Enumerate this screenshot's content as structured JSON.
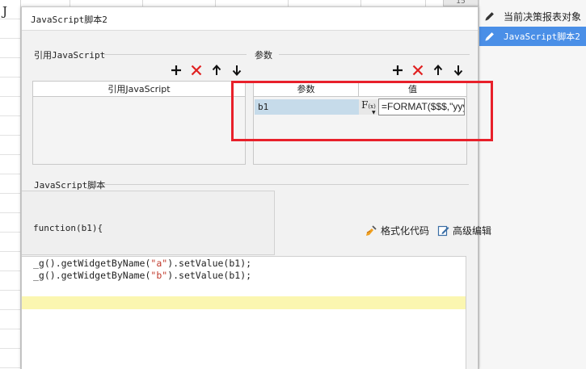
{
  "spreadsheet": {
    "column_label": "J",
    "cell_number": "15"
  },
  "dialog": {
    "title": "JavaScript脚本2"
  },
  "ref_section": {
    "title": "引用JavaScript",
    "column_header": "引用JavaScript"
  },
  "param_section": {
    "title": "参数",
    "col_param": "参数",
    "col_value": "值",
    "rows": [
      {
        "name": "b1",
        "value": "=FORMAT($$$,\"yyy"
      }
    ],
    "fx_label": "F",
    "fx_sub": "(x)"
  },
  "script_section": {
    "title": "JavaScript脚本",
    "func_signature": "function(b1){",
    "format_label": "格式化代码",
    "advanced_label": "高级编辑",
    "code_lines": [
      {
        "p1": "_g().getWidgetByName(",
        "s": "\"a\"",
        "p2": ").setValue(b1);"
      },
      {
        "p1": "_g().getWidgetByName(",
        "s": "\"b\"",
        "p2": ").setValue(b1);"
      }
    ]
  },
  "right_panel": {
    "items": [
      {
        "label": "当前决策报表对象"
      },
      {
        "label": "JavaScript脚本2"
      }
    ]
  },
  "colors": {
    "highlight_box": "#e8202a",
    "selected_item": "#4a8fe7",
    "delete_icon": "#e02020"
  }
}
